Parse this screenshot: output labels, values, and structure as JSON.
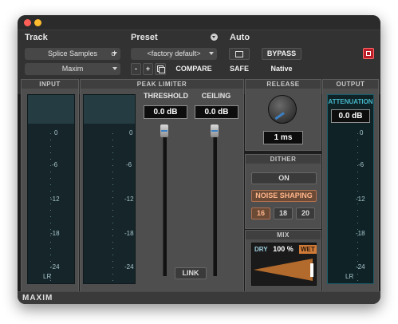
{
  "header": {
    "track_label": "Track",
    "track_name": "Splice Samples",
    "track_suffix": "d",
    "plugin_name": "Maxim",
    "preset_label": "Preset",
    "preset_name": "<factory default>",
    "auto_label": "Auto",
    "minus": "-",
    "plus": "+",
    "compare": "COMPARE",
    "safe": "SAFE",
    "bypass": "BYPASS",
    "native": "Native"
  },
  "input": {
    "title": "INPUT",
    "lr": "LR"
  },
  "limiter": {
    "title": "PEAK LIMITER",
    "threshold_label": "THRESHOLD",
    "threshold_value": "0.0 dB",
    "ceiling_label": "CEILING",
    "ceiling_value": "0.0 dB",
    "link": "LINK"
  },
  "scale": [
    "0",
    "-6",
    "-12",
    "-18",
    "-24"
  ],
  "release": {
    "title": "RELEASE",
    "value": "1 ms"
  },
  "dither": {
    "title": "DITHER",
    "on": "ON",
    "noise_shaping": "NOISE SHAPING",
    "bits": [
      "16",
      "18",
      "20"
    ]
  },
  "mix": {
    "title": "MIX",
    "dry": "DRY",
    "value": "100 %",
    "wet": "WET"
  },
  "output": {
    "title": "OUTPUT",
    "attenuation": "ATTENUATION",
    "value": "0.0 dB",
    "lr": "LR"
  },
  "footer": {
    "name": "MAXIM"
  },
  "colors": {
    "accent_blue": "#3c80c4",
    "active_orange": "#ffb58a",
    "meter_teal": "#1c5c6a"
  }
}
